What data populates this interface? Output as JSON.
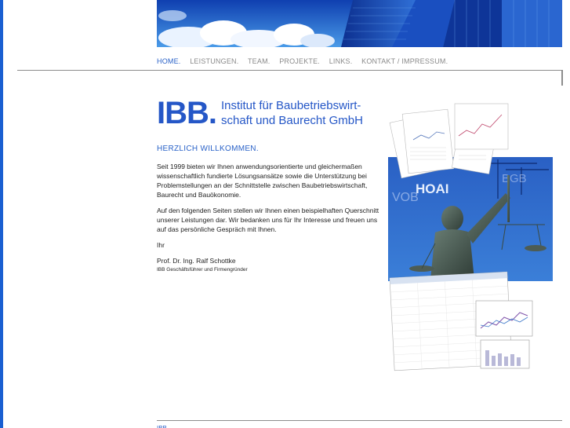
{
  "nav": {
    "items": [
      "HOME.",
      "LEISTUNGEN.",
      "TEAM.",
      "PROJEKTE.",
      "LINKS.",
      "KONTAKT / IMPRESSUM."
    ],
    "active": "HOME."
  },
  "logo": {
    "mark": "IBB.",
    "line1": "Institut für Baubetriebswirt-",
    "line2": "schaft und Baurecht GmbH"
  },
  "welcome_heading": "HERZLICH WILLKOMMEN.",
  "intro": {
    "para1": "Seit 1999 bieten wir Ihnen anwendungsorientierte und gleichermaßen wissenschaftlich fundierte Lösungsansätze sowie die Unterstützung bei Problemstellungen an der Schnittstelle zwischen Baubetriebswirtschaft, Baurecht und Bauökonomie.",
    "para2": "Auf den folgenden Seiten stellen wir Ihnen einen beispielhaften Querschnitt unserer Leistungen dar. Wir bedanken uns für Ihr Interesse und freuen uns auf das persönliche Gespräch mit Ihnen.",
    "closing": "Ihr",
    "signature_name": "Prof. Dr. Ing. Ralf Schottke",
    "signature_title": "IBB Geschäftsführer und Firmengründer"
  },
  "collage": {
    "hoai_label": "HOAI",
    "vob_label": "VOB",
    "bgb_label": "BGB"
  },
  "footer": {
    "link": "IBB"
  },
  "colors": {
    "accent": "#2557c7",
    "nav_inactive": "#8a8a8a",
    "stripe": "#1a5fd1"
  }
}
